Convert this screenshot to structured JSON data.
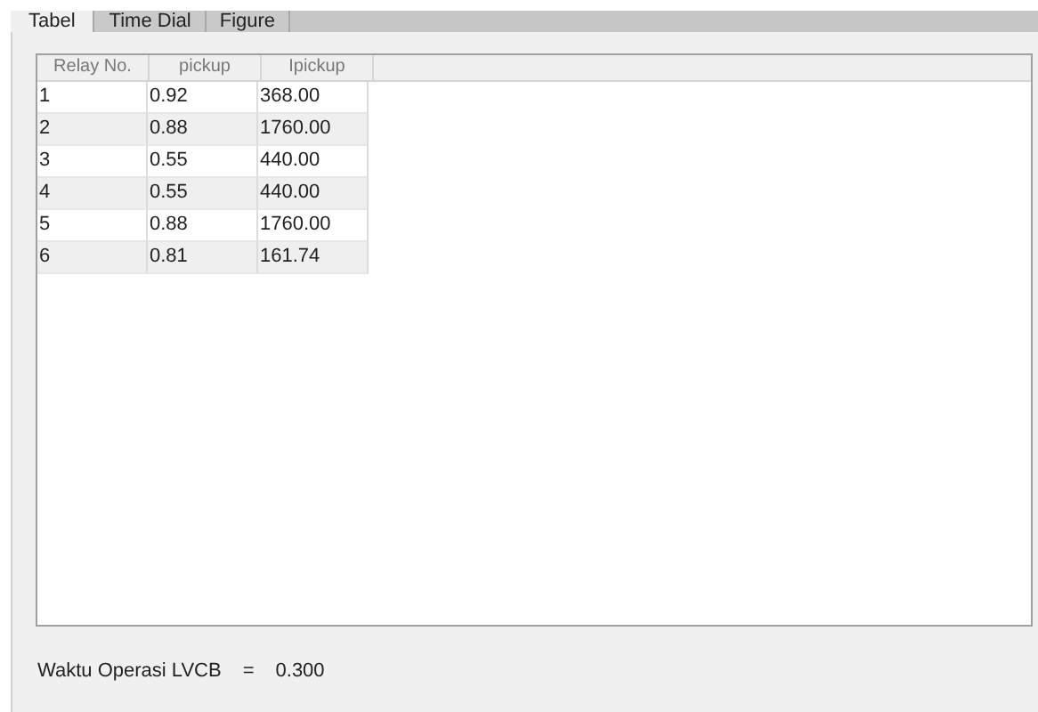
{
  "tabs": [
    {
      "label": "Tabel",
      "selected": true
    },
    {
      "label": "Time Dial",
      "selected": false
    },
    {
      "label": "Figure",
      "selected": false
    }
  ],
  "table": {
    "columns": [
      "Relay No.",
      "pickup",
      "Ipickup"
    ],
    "rows": [
      [
        "1",
        "0.92",
        "368.00"
      ],
      [
        "2",
        "0.88",
        "1760.00"
      ],
      [
        "3",
        "0.55",
        "440.00"
      ],
      [
        "4",
        "0.55",
        "440.00"
      ],
      [
        "5",
        "0.88",
        "1760.00"
      ],
      [
        "6",
        "0.81",
        "161.74"
      ]
    ]
  },
  "result": {
    "label": "Waktu Operasi LVCB",
    "equals": "=",
    "value": "0.300"
  }
}
